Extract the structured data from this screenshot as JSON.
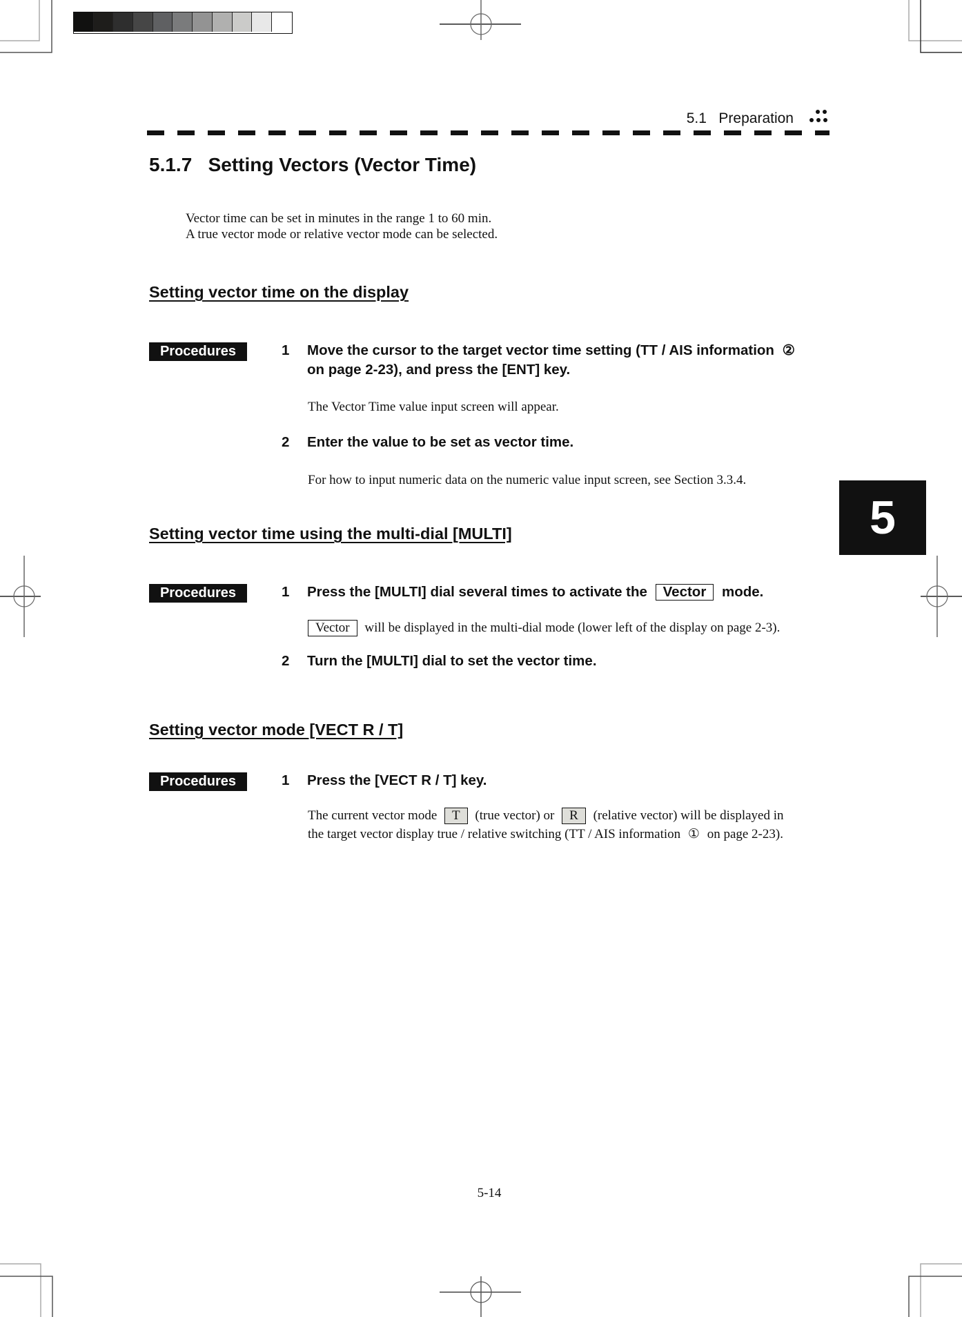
{
  "header": {
    "section_number": "5.1",
    "section_title": "Preparation"
  },
  "title": "5.1.7   Setting Vectors (Vector Time)",
  "intro": [
    "Vector time can be set in minutes in the range 1 to 60 min.",
    "A true vector mode or relative vector mode can be selected."
  ],
  "chapter_tab": "5",
  "sections": [
    {
      "heading": "Setting vector time on the display",
      "badge": "Procedures",
      "steps": [
        {
          "number": "1",
          "text_line1_before": "Move the cursor to the target vector time setting (TT / AIS information ",
          "text_line1_symbol": "②",
          "text_line2": "on page 2-23), and press the [ENT] key.",
          "note": "The Vector Time value input screen will appear."
        },
        {
          "number": "2",
          "text": "Enter the value to be set as vector time.",
          "note": "For how to input numeric data on the numeric value input screen, see Section 3.3.4."
        }
      ]
    },
    {
      "heading": "Setting vector time using the multi-dial [MULTI]",
      "badge": "Procedures",
      "steps": [
        {
          "number": "1",
          "text_before": "Press the [MULTI] dial several times to activate the",
          "text_boxed": "Vector",
          "text_after": "mode.",
          "note_boxed": "Vector",
          "note_after": "will be displayed in the multi-dial mode (lower left of the display on page 2-3)."
        },
        {
          "number": "2",
          "text": "Turn the [MULTI] dial to set the vector time."
        }
      ]
    },
    {
      "heading": "Setting vector mode [VECT R / T]",
      "badge": "Procedures",
      "steps": [
        {
          "number": "1",
          "text": "Press the [VECT R / T] key.",
          "note_line1_a": "The current vector mode",
          "note_line1_box1": "T",
          "note_line1_b": "(true vector) or",
          "note_line1_box2": "R",
          "note_line1_c": "(relative vector) will be displayed in",
          "note_line2_a": "the target vector display true / relative switching (TT / AIS information",
          "note_line2_symbol": "①",
          "note_line2_b": "on page 2-23)."
        }
      ]
    }
  ],
  "page_number": "5-14",
  "colors": {
    "ink": "#111111",
    "key_box_fill": "#deded9",
    "grayscale_bar": [
      "#111110",
      "#1e1d1b",
      "#2e2e2e",
      "#464646",
      "#5f6062",
      "#7a7b7c",
      "#939393",
      "#b0b0af",
      "#cbcbc9",
      "#e8e8e8",
      "#ffffff"
    ]
  }
}
